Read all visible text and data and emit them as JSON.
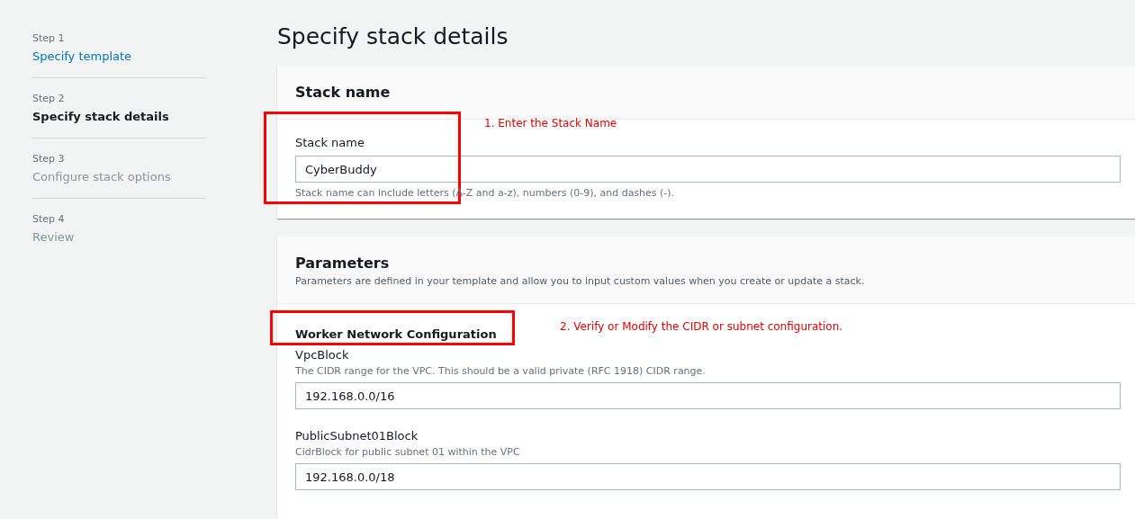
{
  "steps": [
    {
      "label": "Step 1",
      "title": "Specify template",
      "kind": "link"
    },
    {
      "label": "Step 2",
      "title": "Specify stack details",
      "kind": "current"
    },
    {
      "label": "Step 3",
      "title": "Configure stack options",
      "kind": "upcoming"
    },
    {
      "label": "Step 4",
      "title": "Review",
      "kind": "upcoming"
    }
  ],
  "page_title": "Specify stack details",
  "stack_panel": {
    "heading": "Stack name",
    "field_label": "Stack name",
    "value": "CyberBuddy",
    "hint": "Stack name can include letters (A-Z and a-z), numbers (0-9), and dashes (-).",
    "annotation": "1. Enter the Stack Name"
  },
  "parameters_panel": {
    "heading": "Parameters",
    "description": "Parameters are defined in your template and allow you to input custom values when you create or update a stack.",
    "group_heading": "Worker Network Configuration",
    "annotation": "2. Verify or Modify the CIDR or subnet configuration.",
    "fields": [
      {
        "label": "VpcBlock",
        "description": "The CIDR range for the VPC. This should be a valid private (RFC 1918) CIDR range.",
        "value": "192.168.0.0/16"
      },
      {
        "label": "PublicSubnet01Block",
        "description": "CidrBlock for public subnet 01 within the VPC",
        "value": "192.168.0.0/18"
      }
    ]
  }
}
